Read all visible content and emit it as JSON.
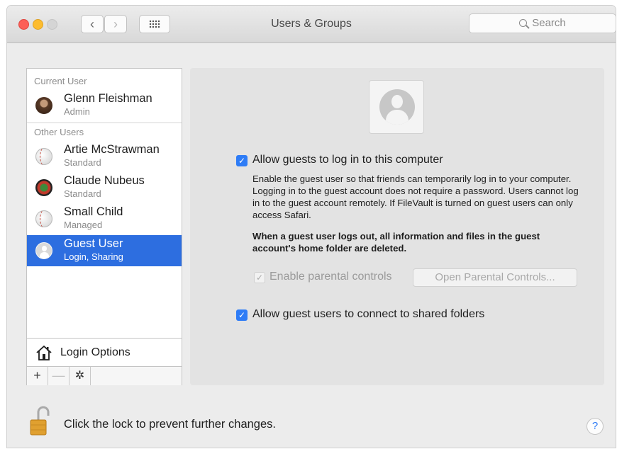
{
  "window": {
    "title": "Users & Groups"
  },
  "toolbar": {
    "back_icon": "chevron-left-icon",
    "back_glyph": "‹",
    "forward_icon": "chevron-right-icon",
    "forward_glyph": "›",
    "grid_icon": "show-all-grid-icon",
    "search_placeholder": "Search"
  },
  "sidebar": {
    "current_user_label": "Current User",
    "current_user": {
      "name": "Glenn Fleishman",
      "role": "Admin"
    },
    "other_users_label": "Other Users",
    "other_users": [
      {
        "name": "Artie McStrawman",
        "role": "Standard",
        "avatar": "baseball"
      },
      {
        "name": "Claude Nubeus",
        "role": "Standard",
        "avatar": "flower"
      },
      {
        "name": "Small Child",
        "role": "Managed",
        "avatar": "baseball"
      },
      {
        "name": "Guest User",
        "role": "Login, Sharing",
        "avatar": "silhouette",
        "selected": true
      }
    ],
    "login_options_label": "Login Options",
    "add_glyph": "+",
    "remove_glyph": "—",
    "gear_glyph": "✲"
  },
  "panel": {
    "allow_guests": {
      "label": "Allow guests to log in to this computer",
      "checked": true
    },
    "description": "Enable the guest user so that friends can temporarily log in to your computer. Logging in to the guest account does not require a password. Users cannot log in to the guest account remotely. If FileVault is turned on guest users can only access Safari.",
    "warning": "When a guest user logs out, all information and files in the guest account's home folder are deleted.",
    "parental_controls": {
      "label": "Enable parental controls",
      "checked": true,
      "enabled": false
    },
    "open_parental_button": "Open Parental Controls...",
    "shared_folders": {
      "label": "Allow guest users to connect to shared folders",
      "checked": true
    },
    "check_glyph": "✓"
  },
  "footer": {
    "lock_text": "Click the lock to prevent further changes.",
    "help_glyph": "?"
  },
  "colors": {
    "accent": "#2e7cf6",
    "selection": "#2d6ee0"
  }
}
